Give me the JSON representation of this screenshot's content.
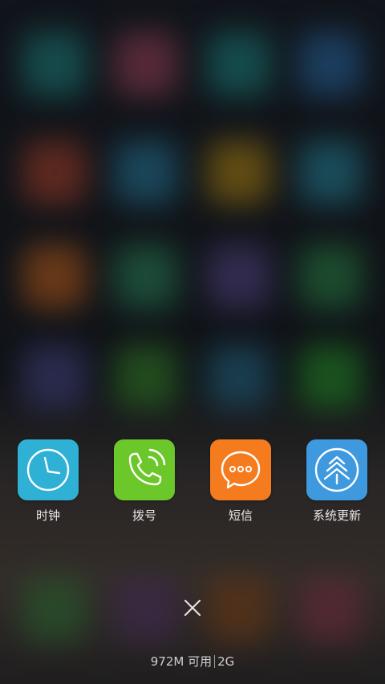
{
  "colors": {
    "clock_tile": "#2fb1d6",
    "dialer_tile": "#6cc72a",
    "messages_tile": "#f57b1f",
    "updater_tile": "#3e99de",
    "label_text": "#e8e8e8"
  },
  "background_blobs": [
    {
      "color": "#1f8a84"
    },
    {
      "color": "#a3465c"
    },
    {
      "color": "#1f8a84"
    },
    {
      "color": "#2b6ea8"
    },
    {
      "color": "#b2442c"
    },
    {
      "color": "#2a7fa0"
    },
    {
      "color": "#b78b12"
    },
    {
      "color": "#2a8ba0"
    },
    {
      "color": "#c8641c"
    },
    {
      "color": "#2e8a5c"
    },
    {
      "color": "#5a4a8c"
    },
    {
      "color": "#2e8a4a"
    },
    {
      "color": "#4a4a8a"
    },
    {
      "color": "#3a8a2a"
    },
    {
      "color": "#2a6e8a"
    },
    {
      "color": "#2a9a2a"
    },
    {
      "color": "#3a7a3a"
    },
    {
      "color": "#5a3a6a"
    },
    {
      "color": "#8a4a1a"
    },
    {
      "color": "#8a3a4a"
    }
  ],
  "recent_apps": [
    {
      "label": "时钟",
      "icon": "clock-icon"
    },
    {
      "label": "拨号",
      "icon": "phone-icon"
    },
    {
      "label": "短信",
      "icon": "message-icon"
    },
    {
      "label": "系统更新",
      "icon": "tree-update-icon"
    }
  ],
  "close_button": {
    "icon": "close-icon"
  },
  "memory": {
    "available": "972M 可用",
    "total": "2G"
  }
}
